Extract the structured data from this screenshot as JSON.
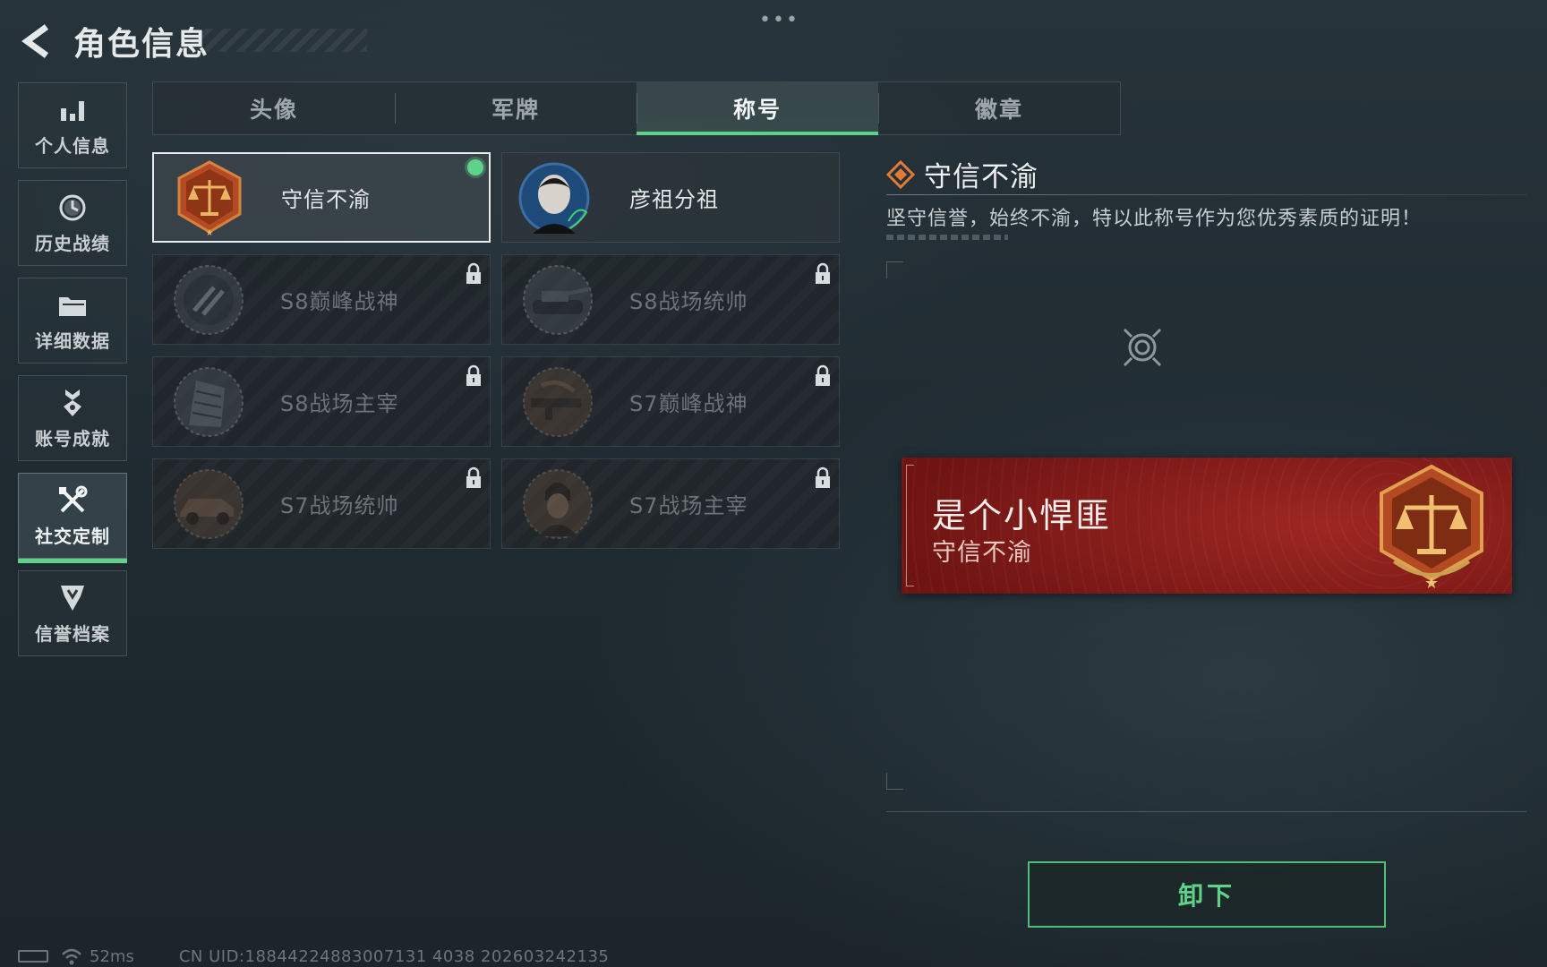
{
  "header": {
    "title": "角色信息"
  },
  "sidebar": {
    "items": [
      {
        "label": "个人信息",
        "icon": "bar-chart-icon",
        "active": false
      },
      {
        "label": "历史战绩",
        "icon": "clock-history-icon",
        "active": false
      },
      {
        "label": "详细数据",
        "icon": "folder-icon",
        "active": false
      },
      {
        "label": "账号成就",
        "icon": "achievement-medal-icon",
        "active": false
      },
      {
        "label": "社交定制",
        "icon": "tools-icon",
        "active": true
      },
      {
        "label": "信誉档案",
        "icon": "credit-badge-icon",
        "active": false
      }
    ]
  },
  "tabs": [
    {
      "label": "头像",
      "active": false
    },
    {
      "label": "军牌",
      "active": false
    },
    {
      "label": "称号",
      "active": true
    },
    {
      "label": "徽章",
      "active": false
    }
  ],
  "titles": [
    {
      "name": "守信不渝",
      "state": "equipped",
      "emblem": "justice-scale-emblem"
    },
    {
      "name": "彦祖分祖",
      "state": "unlocked",
      "emblem": "portrait-signature-emblem"
    },
    {
      "name": "S8巅峰战神",
      "state": "locked",
      "emblem": "s8-peak-emblem"
    },
    {
      "name": "S8战场统帅",
      "state": "locked",
      "emblem": "tank-emblem"
    },
    {
      "name": "S8战场主宰",
      "state": "locked",
      "emblem": "building-emblem"
    },
    {
      "name": "S7巅峰战神",
      "state": "locked",
      "emblem": "rifle-emblem"
    },
    {
      "name": "S7战场统帅",
      "state": "locked",
      "emblem": "vehicle-emblem"
    },
    {
      "name": "S7战场主宰",
      "state": "locked",
      "emblem": "soldier-emblem"
    }
  ],
  "detail": {
    "title": "守信不渝",
    "description": "坚守信誉，始终不渝，特以此称号作为您优秀素质的证明！",
    "preview": {
      "player_name": "是个小悍匪",
      "title": "守信不渝"
    },
    "button_label": "卸下"
  },
  "status": {
    "ping": "52ms",
    "uid": "CN UID:18844224883007131 4038 202603242135"
  },
  "colors": {
    "accent_green": "#5fd28a",
    "plate_red": "#8a1c18",
    "emblem_orange": "#c0582a"
  }
}
